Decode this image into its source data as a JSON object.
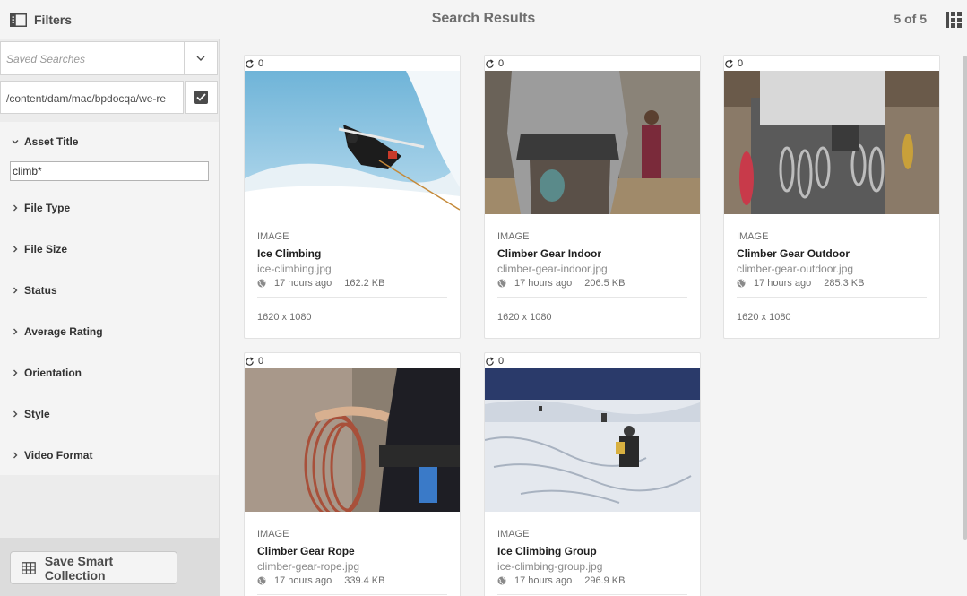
{
  "header": {
    "filters_label": "Filters",
    "title": "Search Results",
    "count": "5 of 5"
  },
  "sidebar": {
    "saved_searches_placeholder": "Saved Searches",
    "path_value": "/content/dam/mac/bpdocqa/we-re",
    "facets": [
      {
        "label": "Asset Title",
        "expanded": true
      },
      {
        "label": "File Type",
        "expanded": false
      },
      {
        "label": "File Size",
        "expanded": false
      },
      {
        "label": "Status",
        "expanded": false
      },
      {
        "label": "Average Rating",
        "expanded": false
      },
      {
        "label": "Orientation",
        "expanded": false
      },
      {
        "label": "Style",
        "expanded": false
      },
      {
        "label": "Video Format",
        "expanded": false
      }
    ],
    "asset_title_value": "climb*",
    "save_collection_label": "Save Smart Collection"
  },
  "cards": [
    {
      "revisions": "0",
      "type": "IMAGE",
      "title": "Ice Climbing",
      "file": "ice-climbing.jpg",
      "modified": "17 hours ago",
      "size": "162.2 KB",
      "dims": "1620 x 1080",
      "thumb_icon": "ice-climber-photo"
    },
    {
      "revisions": "0",
      "type": "IMAGE",
      "title": "Climber Gear Indoor",
      "file": "climber-gear-indoor.jpg",
      "modified": "17 hours ago",
      "size": "206.5 KB",
      "dims": "1620 x 1080",
      "thumb_icon": "harness-back-photo"
    },
    {
      "revisions": "0",
      "type": "IMAGE",
      "title": "Climber Gear Outdoor",
      "file": "climber-gear-outdoor.jpg",
      "modified": "17 hours ago",
      "size": "285.3 KB",
      "dims": "1620 x 1080",
      "thumb_icon": "carabiners-photo"
    },
    {
      "revisions": "0",
      "type": "IMAGE",
      "title": "Climber Gear Rope",
      "file": "climber-gear-rope.jpg",
      "modified": "17 hours ago",
      "size": "339.4 KB",
      "dims": "",
      "thumb_icon": "rope-coil-photo"
    },
    {
      "revisions": "0",
      "type": "IMAGE",
      "title": "Ice Climbing Group",
      "file": "ice-climbing-group.jpg",
      "modified": "17 hours ago",
      "size": "296.9 KB",
      "dims": "",
      "thumb_icon": "glacier-group-photo"
    }
  ]
}
